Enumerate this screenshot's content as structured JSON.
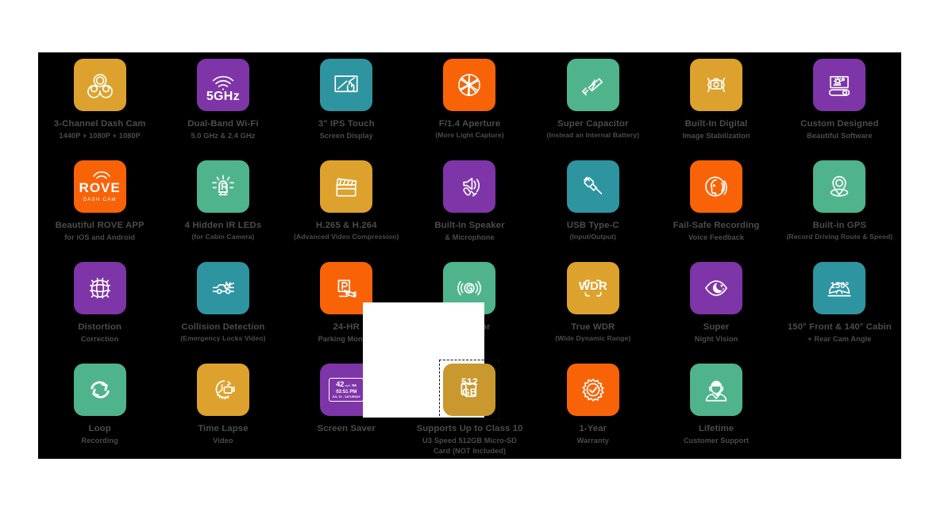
{
  "board": {
    "background_color": "#000000",
    "caption_color": "#4c4c4c",
    "palette": {
      "amber": "#DDA22D",
      "purple": "#7E35A8",
      "teal": "#2E94A0",
      "orange": "#F96308",
      "green": "#4FB48C",
      "gold": "#C9992F"
    },
    "columns": 7,
    "rows": 4
  },
  "features": [
    {
      "icon": "three-lens-dash-cam-icon",
      "color": "#DDA22D",
      "title": "3-Channel Dash Cam",
      "subtitle": "1440P + 1080P + 1080P",
      "sub_small": false
    },
    {
      "icon": "wifi-5ghz-icon",
      "color": "#7E35A8",
      "title": "Dual-Band Wi-Fi",
      "subtitle": "5.0 GHz & 2.4 GHz",
      "sub_small": false
    },
    {
      "icon": "touch-screen-icon",
      "color": "#2E94A0",
      "title": "3\" IPS Touch",
      "subtitle": "Screen Display",
      "sub_small": false
    },
    {
      "icon": "aperture-icon",
      "color": "#F96308",
      "title": "F/1.4 Aperture",
      "subtitle": "(More Light Capture)",
      "sub_small": true
    },
    {
      "icon": "capacitor-icon",
      "color": "#4FB48C",
      "title": "Super Capacitor",
      "subtitle": "(Instead an Internal Battery)",
      "sub_small": true
    },
    {
      "icon": "image-stabilization-icon",
      "color": "#DDA22D",
      "title": "Built-In Digital",
      "subtitle": "Image Stabilization",
      "sub_small": false
    },
    {
      "icon": "custom-software-icon",
      "color": "#7E35A8",
      "title": "Custom Designed",
      "subtitle": "Beautiful Software",
      "sub_small": false
    },
    {
      "icon": "rove-app-logo-icon",
      "color": "#F96308",
      "title": "Beautiful ROVE APP",
      "subtitle": "for iOS and Android",
      "sub_small": false
    },
    {
      "icon": "ir-led-icon",
      "color": "#4FB48C",
      "title": "4 Hidden IR LEDs",
      "subtitle": "(for Cabin Camera)",
      "sub_small": true
    },
    {
      "icon": "clapperboard-icon",
      "color": "#DDA22D",
      "title": "H.265 & H.264",
      "subtitle": "(Advanced Video Compression)",
      "sub_small": true
    },
    {
      "icon": "speaker-mic-icon",
      "color": "#7E35A8",
      "title": "Built-In Speaker",
      "subtitle": "& Microphone",
      "sub_small": false
    },
    {
      "icon": "usb-type-c-icon",
      "color": "#2E94A0",
      "title": "USB Type-C",
      "subtitle": "(Input/Output)",
      "sub_small": true
    },
    {
      "icon": "voice-feedback-icon",
      "color": "#F96308",
      "title": "Fail-Safe Recording",
      "subtitle": "Voice Feedback",
      "sub_small": false
    },
    {
      "icon": "gps-pin-icon",
      "color": "#4FB48C",
      "title": "Built-in GPS",
      "subtitle": "(Record Driving Route & Speed)",
      "sub_small": true
    },
    {
      "icon": "distortion-grid-icon",
      "color": "#7E35A8",
      "title": "Distortion",
      "subtitle": "Correction",
      "sub_small": false
    },
    {
      "icon": "collision-icon",
      "color": "#2E94A0",
      "title": "Collision Detection",
      "subtitle": "(Emergency Locks Video)",
      "sub_small": true
    },
    {
      "icon": "parking-monitor-icon",
      "color": "#F96308",
      "title": "24-HR",
      "subtitle": "Parking Monitor",
      "sub_small": false
    },
    {
      "icon": "g-sensor-icon",
      "color": "#4FB48C",
      "title": "G-Sensor",
      "subtitle": "",
      "sub_small": false
    },
    {
      "icon": "wdr-icon",
      "color": "#DDA22D",
      "title": "True WDR",
      "subtitle": "(Wide Dynamic Range)",
      "sub_small": true
    },
    {
      "icon": "night-vision-eye-icon",
      "color": "#7E35A8",
      "title": "Super",
      "subtitle": "Night Vision",
      "sub_small": false
    },
    {
      "icon": "viewing-angle-icon",
      "color": "#2E94A0",
      "title": "150° Front & 140° Cabin",
      "subtitle": "+ Rear Cam Angle",
      "sub_small": false
    },
    {
      "icon": "loop-recording-icon",
      "color": "#4FB48C",
      "title": "Loop",
      "subtitle": "Recording",
      "sub_small": false
    },
    {
      "icon": "time-lapse-icon",
      "color": "#DDA22D",
      "title": "Time Lapse",
      "subtitle": "Video",
      "sub_small": false
    },
    {
      "icon": "screen-saver-icon",
      "color": "#7E35A8",
      "title": "Screen Saver",
      "subtitle": "",
      "sub_small": false
    },
    {
      "icon": "micro-sd-card-icon",
      "color": "#C9992F",
      "title": "Supports Up to Class 10",
      "subtitle": "U3 Speed 512GB Micro-SD",
      "line3": "Card (NOT Included)",
      "sub_small": false,
      "selected": true
    },
    {
      "icon": "warranty-badge-icon",
      "color": "#F96308",
      "title": "1-Year",
      "subtitle": "Warranty",
      "sub_small": false
    },
    {
      "icon": "customer-support-icon",
      "color": "#4FB48C",
      "title": "Lifetime",
      "subtitle": "Customer Support",
      "sub_small": false
    },
    {
      "icon": "",
      "color": "",
      "title": "",
      "subtitle": "",
      "empty": true
    }
  ],
  "icon_texts": {
    "wifi_band": "5GHz",
    "touch_size": "3\"",
    "ir_label": "IR",
    "wdr_label": "WDR",
    "g_label": "G",
    "parking_label": "P",
    "angle_label": "150º",
    "sd_capacity_top": "512",
    "sd_capacity_bottom": "GB",
    "rove_logo": "ROVE",
    "rove_sub": "DASH CAM",
    "screensaver_speed": "42",
    "screensaver_speed_unit": "mph",
    "screensaver_heading": "NE",
    "screensaver_time": "03:51 PM",
    "screensaver_date": "JUL 10 - SATURDAY"
  }
}
